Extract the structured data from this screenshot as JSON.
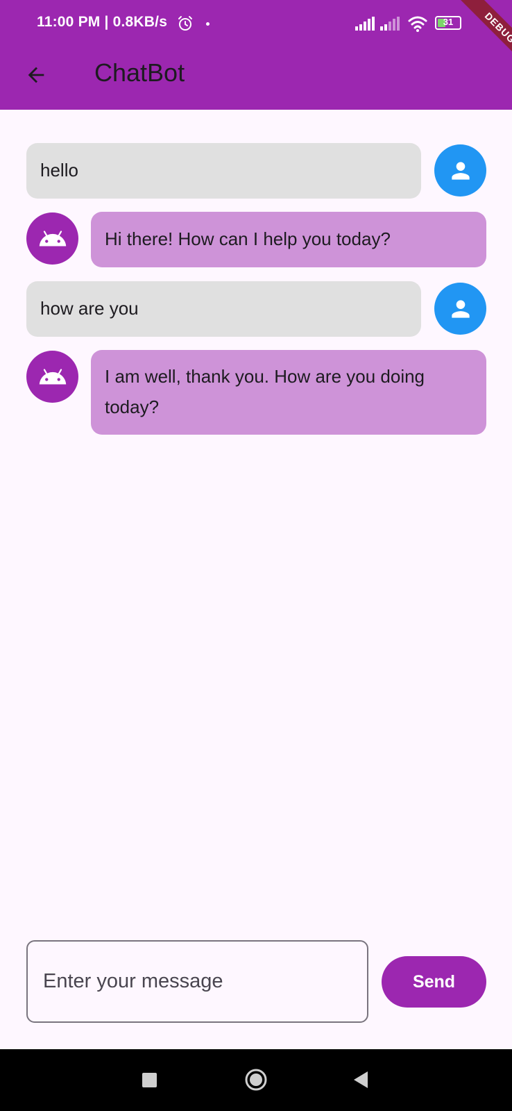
{
  "status_bar": {
    "time": "11:00 PM | 0.8KB/s",
    "battery": "31",
    "debug_label": "DEBUG"
  },
  "app_bar": {
    "title": "ChatBot",
    "back_icon": "arrow-left-icon"
  },
  "messages": [
    {
      "sender": "user",
      "text": "hello",
      "avatar_icon": "person-icon"
    },
    {
      "sender": "bot",
      "text": "Hi there! How can I help you today?",
      "avatar_icon": "android-icon"
    },
    {
      "sender": "user",
      "text": "how are you",
      "avatar_icon": "person-icon"
    },
    {
      "sender": "bot",
      "text": "I am well, thank you. How are you doing today?",
      "avatar_icon": "android-icon"
    }
  ],
  "composer": {
    "placeholder": "Enter your message",
    "value": "",
    "send_label": "Send"
  },
  "colors": {
    "primary": "#9C27B0",
    "user_bubble": "#E0E0E0",
    "bot_bubble": "#CE93D8",
    "user_avatar": "#2196F3",
    "background": "#FEF7FF"
  }
}
